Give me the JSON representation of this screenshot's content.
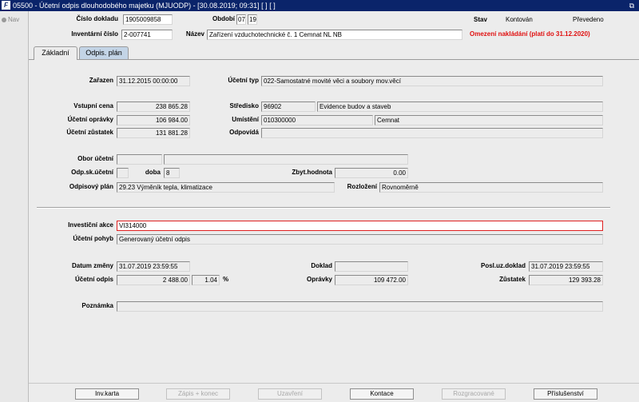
{
  "window": {
    "title": "05500 - Účetní odpis dlouhodobého majetku (MJUODP) - [30.08.2019; 09:31]  [ ]  [ ]",
    "icon_glyph": "F",
    "restore_glyph": "⧉"
  },
  "nav": {
    "label": "Nav"
  },
  "header": {
    "cislo_dokladu_label": "Číslo dokladu",
    "cislo_dokladu": "1905009858",
    "obdobi_label": "Období",
    "obdobi_mesic": "07",
    "obdobi_rok": "19",
    "stav_label": "Stav",
    "stav_value": "Kontován",
    "prevedeno": "Převedeno",
    "inventarni_cislo_label": "Inventární číslo",
    "inventarni_cislo": "2-007741",
    "nazev_label": "Název",
    "nazev": "Zařízení vzduchotechnické č. 1 Cemnat NL NB",
    "omezeni": "Omezení nakládání (platí do 31.12.2020)"
  },
  "tabs": [
    {
      "label": "Základní"
    },
    {
      "label": "Odpis. plán"
    }
  ],
  "form": {
    "zarazen_label": "Zařazen",
    "zarazen": "31.12.2015 00:00:00",
    "ucetni_typ_label": "Účetní typ",
    "ucetni_typ": "022-Samostatné movité věci a soubory mov.věcí",
    "vstupni_cena_label": "Vstupní cena",
    "vstupni_cena": "238 865.28",
    "stredisko_label": "Středisko",
    "stredisko_kod": "96902",
    "stredisko_nazev": "Evidence budov a staveb",
    "ucetni_opravky_label": "Účetní oprávky",
    "ucetni_opravky": "106 984.00",
    "umisteni_label": "Umístění",
    "umisteni_kod": "010300000",
    "umisteni_nazev": "Cemnat",
    "ucetni_zustatek_label": "Účetní zůstatek",
    "ucetni_zustatek": "131 881.28",
    "odpovida_label": "Odpovídá",
    "odpovida": "",
    "obor_ucetni_label": "Obor účetní",
    "obor_ucetni_kod": "",
    "obor_ucetni_nazev": "",
    "odp_sk_ucetni_label": "Odp.sk.účetní",
    "odp_sk_ucetni": "",
    "doba_label": "doba",
    "doba": "8",
    "zbyt_hodnota_label": "Zbyt.hodnota",
    "zbyt_hodnota": "0.00",
    "odpisovy_plan_label": "Odpisový plán",
    "odpisovy_plan": "29.23 Výměník tepla, klimatizace",
    "rozlozeni_label": "Rozložení",
    "rozlozeni": "Rovnoměrně",
    "investicni_akce_label": "Investiční akce",
    "investicni_akce": "VI314000",
    "ucetni_pohyb_label": "Účetní pohyb",
    "ucetni_pohyb": "Generovaný účetní odpis",
    "datum_zmeny_label": "Datum změny",
    "datum_zmeny": "31.07.2019 23:59:55",
    "doklad_label": "Doklad",
    "doklad": "",
    "posl_uz_doklad_label": "Posl.uz.doklad",
    "posl_uz_doklad": "31.07.2019 23:59:55",
    "ucetni_odpis_label": "Účetní odpis",
    "ucetni_odpis": "2 488.00",
    "ucetni_odpis_procento": "1.04",
    "procento_znak": "%",
    "opravky_label": "Oprávky",
    "opravky": "109 472.00",
    "zustatek_label": "Zůstatek",
    "zustatek": "129 393.28",
    "poznamka_label": "Poznámka",
    "poznamka": ""
  },
  "buttons": {
    "inv_karta": "Inv.karta",
    "zapis_konec": "Zápis + konec",
    "uzavreni": "Uzavření",
    "kontace": "Kontace",
    "rozgracovane": "Rozgracované",
    "prislusenstvi": "Příslušenství"
  },
  "colors": {
    "titlebar": "#0a246a",
    "warning": "#e01010",
    "tab_inactive": "#c3d4e6"
  }
}
